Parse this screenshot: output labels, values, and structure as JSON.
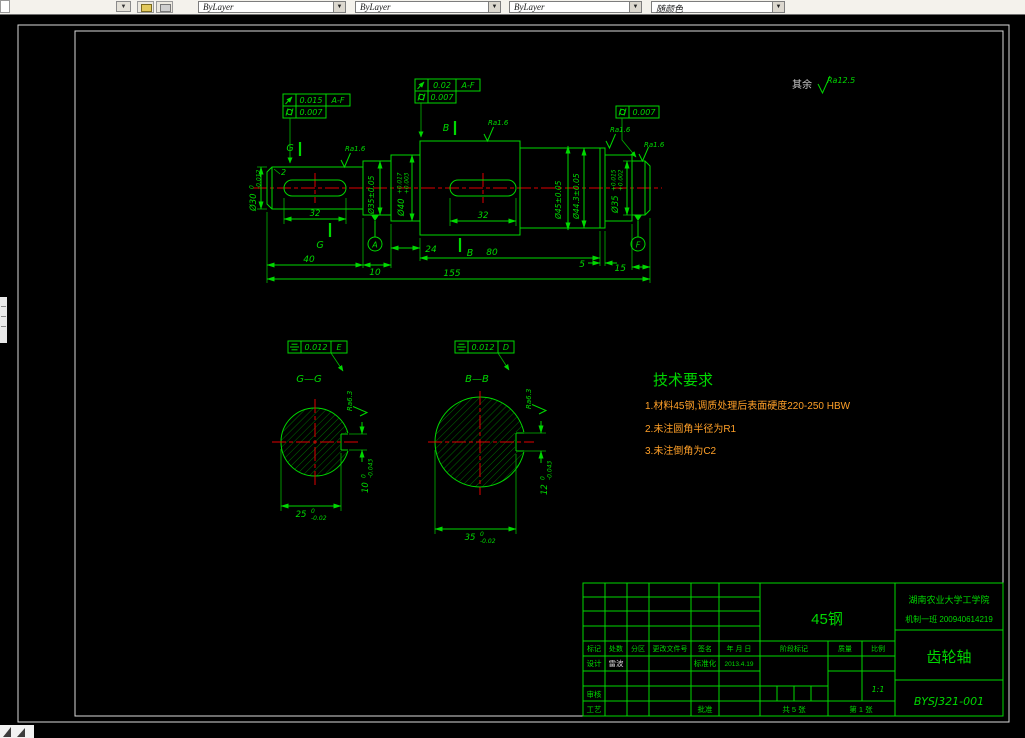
{
  "toolbar": {
    "combo1": "ByLayer",
    "combo2": "ByLayer",
    "combo3": "ByLayer",
    "combo4": "随颜色"
  },
  "colors": {
    "line_green": "#00d800",
    "centerline_red": "#e00000",
    "tech_text_orange": "#ffa028",
    "sheet_frame": "#dadada"
  },
  "drawing": {
    "general_roughness": {
      "prefix": "其余",
      "value": "Ra12.5"
    },
    "main_view": {
      "chamfer": "2",
      "d30_main": "Ø30",
      "d30_up": "0",
      "d30_dn": "-0.012",
      "d35_seal": "Ø35±0.05",
      "d40_main": "Ø40",
      "d40_up": "+0.017",
      "d40_dn": "+0.003",
      "d45": "Ø45±0.05",
      "d44": "Ø44.3±0.05",
      "d35e_main": "Ø35",
      "d35e_up": "+0.015",
      "d35e_dn": "+0.002",
      "key1_len": "32",
      "key2_len": "32",
      "len_40": "40",
      "len_10": "10",
      "len_24": "24",
      "len_80": "80",
      "len_5": "5",
      "len_15": "15",
      "len_total": "155",
      "ra1": "Ra1.6",
      "ra2": "Ra1.6",
      "ra3": "Ra1.6",
      "ra4": "Ra1.6",
      "sec_g": "G",
      "sec_b": "B",
      "datum_a": "A",
      "datum_f": "F"
    },
    "gdt": {
      "f1_v1": "0.015",
      "f1_d1": "A-F",
      "f1_v2": "0.007",
      "f2_v1": "0.02",
      "f2_d1": "A-F",
      "f2_v2": "0.007",
      "f3_v": "0.007",
      "gg_v": "0.012",
      "gg_d": "E",
      "bb_v": "0.012",
      "bb_d": "D"
    },
    "section_gg": {
      "title": "G—G",
      "w_main": "25",
      "w_up": "0",
      "w_dn": "-0.02",
      "k_main": "10",
      "k_up": "0",
      "k_dn": "-0.043",
      "ra": "Ra6.3"
    },
    "section_bb": {
      "title": "B—B",
      "w_main": "35",
      "w_up": "0",
      "w_dn": "-0.02",
      "k_main": "12",
      "k_up": "0",
      "k_dn": "-0.043",
      "ra": "Ra6.3"
    },
    "tech": {
      "title": "技术要求",
      "items": [
        "1.材料45钢,调质处理后表面硬度220-250 HBW",
        "2.未注圆角半径为R1",
        "3.未注倒角为C2"
      ]
    }
  },
  "title_block": {
    "school": "湖南农业大学工学院",
    "class_id": "机制一班 200940614219",
    "material": "45钢",
    "part_name": "齿轮轴",
    "drawing_no": "BYSJ321-001",
    "scale_value": "1:1",
    "sheet_total": "共 5 张",
    "sheet_no": "第 1 张",
    "col_mark": "标记",
    "col_count": "处数",
    "col_zone": "分区",
    "col_doc": "更改文件号",
    "col_sign": "签名",
    "col_date": "年 月 日",
    "row_design": "设计",
    "row_check": "审核",
    "row_process": "工艺",
    "row_std": "标准化",
    "row_approve": "批准",
    "designer_name": "雷波",
    "design_date": "2013.4.19",
    "stage_mark": "阶段标记",
    "mass": "质量",
    "scale_label": "比例"
  }
}
